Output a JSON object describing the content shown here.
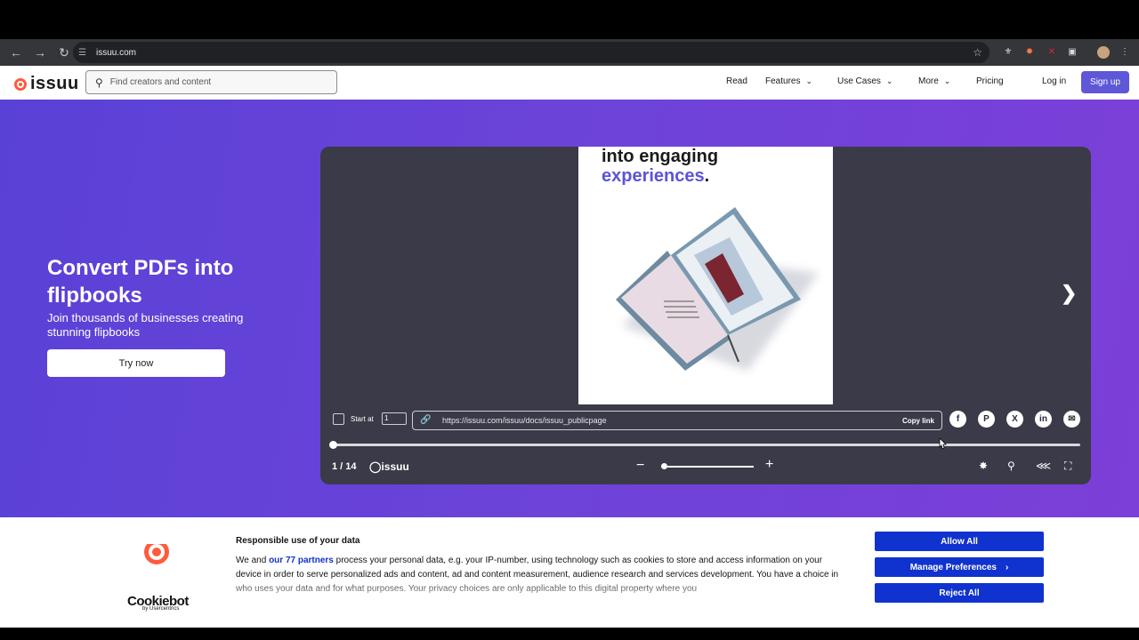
{
  "browser": {
    "url": "issuu.com",
    "nav_icons": [
      "back-icon",
      "forward-icon",
      "reload-icon"
    ]
  },
  "header": {
    "brand": "issuu",
    "search_placeholder": "Find creators and content",
    "nav": {
      "read": "Read",
      "features": "Features",
      "use_cases": "Use Cases",
      "more": "More",
      "pricing": "Pricing",
      "login": "Log in",
      "signup": "Sign up"
    }
  },
  "hero": {
    "title": "Convert PDFs into flipbooks",
    "subtitle": "Join thousands of businesses creating stunning flipbooks",
    "cta": "Try now"
  },
  "viewer": {
    "doc_heading_line1": "into engaging",
    "doc_heading_line2": "experiences",
    "doc_heading_period": ".",
    "start_at_label": "Start at",
    "start_at_value": "1",
    "share_url": "https://issuu.com/issuu/docs/issuu_publicpage",
    "copy_link": "Copy link",
    "share_icons": [
      "facebook-icon",
      "pinterest-icon",
      "x-icon",
      "linkedin-icon",
      "email-icon"
    ],
    "page_counter": "1 / 14",
    "brand": "issuu",
    "progress": 0.0
  },
  "cookie": {
    "brand": "Cookiebot",
    "brand_by": "by Usercentrics",
    "title": "Responsible use of your data",
    "text_before_link": "We and ",
    "link": "our 77 partners",
    "text_after_link": " process your personal data, e.g. your IP-number, using technology such as cookies to store and access information on your device in order to serve personalized ads and content, ad and content measurement, audience research and services development. You have a choice in who uses your data and for what purposes. Your privacy choices are only applicable to this digital property where you",
    "allow_all": "Allow All",
    "manage": "Manage Preferences",
    "reject_all": "Reject All"
  }
}
